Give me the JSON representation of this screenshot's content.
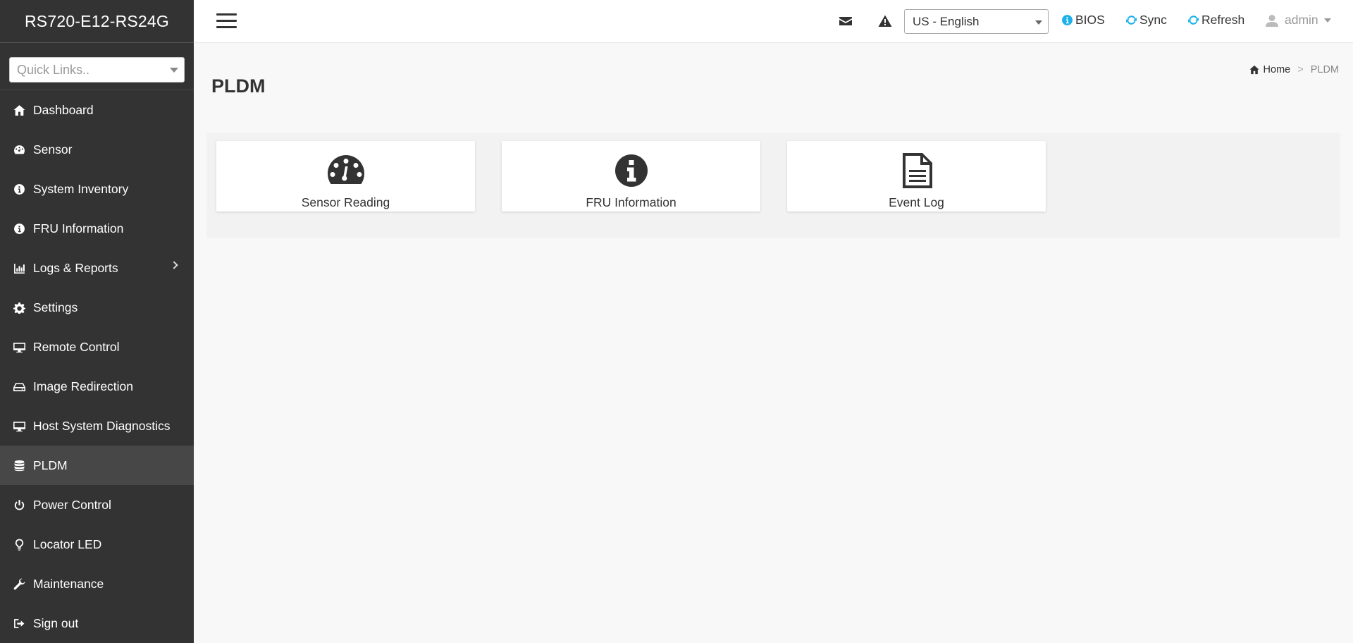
{
  "sidebar": {
    "brand": "RS720-E12-RS24G",
    "quicklinks_placeholder": "Quick Links..",
    "items": [
      {
        "label": "Dashboard",
        "icon": "home-icon"
      },
      {
        "label": "Sensor",
        "icon": "tachometer-icon"
      },
      {
        "label": "System Inventory",
        "icon": "info-circle-icon"
      },
      {
        "label": "FRU Information",
        "icon": "info-circle-icon"
      },
      {
        "label": "Logs & Reports",
        "icon": "bar-chart-icon"
      },
      {
        "label": "Settings",
        "icon": "gear-icon"
      },
      {
        "label": "Remote Control",
        "icon": "desktop-icon"
      },
      {
        "label": "Image Redirection",
        "icon": "hdd-icon"
      },
      {
        "label": "Host System Diagnostics",
        "icon": "desktop-icon"
      },
      {
        "label": "PLDM",
        "icon": "database-icon",
        "active": true
      },
      {
        "label": "Power Control",
        "icon": "power-icon"
      },
      {
        "label": "Locator LED",
        "icon": "lightbulb-icon"
      },
      {
        "label": "Maintenance",
        "icon": "wrench-icon"
      },
      {
        "label": "Sign out",
        "icon": "sign-out-icon"
      }
    ]
  },
  "header": {
    "language": "US - English",
    "bios_label": "BIOS",
    "sync_label": "Sync",
    "refresh_label": "Refresh",
    "user_label": "admin",
    "accent_color": "#1ab0e8"
  },
  "main": {
    "title": "PLDM",
    "breadcrumb": {
      "home": "Home",
      "separator": ">",
      "current": "PLDM"
    },
    "cards": [
      {
        "label": "Sensor Reading",
        "icon": "tachometer-icon"
      },
      {
        "label": "FRU Information",
        "icon": "info-circle-icon"
      },
      {
        "label": "Event Log",
        "icon": "file-text-icon"
      }
    ]
  }
}
